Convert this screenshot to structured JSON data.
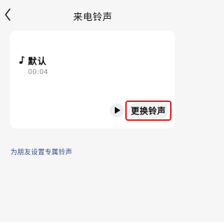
{
  "header": {
    "title": "来电铃声",
    "back_icon": "chevron-left-icon"
  },
  "ringtone": {
    "icon": "music-note-icon",
    "name": "默认",
    "duration": "00:04"
  },
  "controls": {
    "play_icon": "play-icon",
    "change_label": "更换铃声",
    "highlight_color": "#e0171b"
  },
  "friend_link": {
    "label": "为朋友设置专属铃声",
    "color": "#2f4d86"
  }
}
